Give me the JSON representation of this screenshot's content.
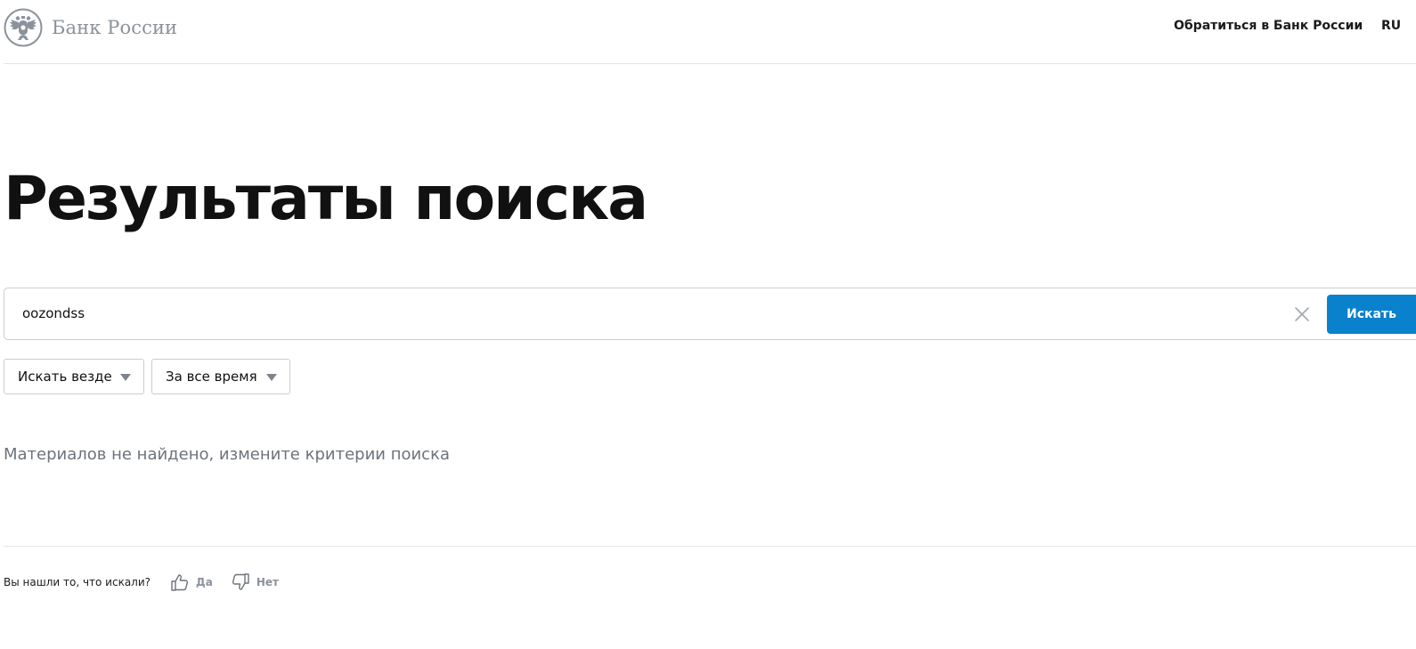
{
  "header": {
    "logo_text": "Банк России",
    "contact_link": "Обратиться в Банк России",
    "language": "RU"
  },
  "page": {
    "title": "Результаты поиска"
  },
  "search": {
    "query": "oozondss",
    "button_label": "Искать",
    "clear_icon": "close-icon"
  },
  "filters": {
    "scope": {
      "selected": "Искать везде"
    },
    "period": {
      "selected": "За все время"
    }
  },
  "results": {
    "empty_message": "Материалов не найдено, измените критерии поиска"
  },
  "feedback": {
    "question": "Вы нашли то, что искали?",
    "yes_label": "Да",
    "no_label": "Нет",
    "yes_icon": "thumbs-up-icon",
    "no_icon": "thumbs-down-icon"
  },
  "colors": {
    "accent": "#0a81cc",
    "logo_gray": "#8a929c",
    "muted_text": "#6d737b",
    "border": "#c8cdd3"
  }
}
